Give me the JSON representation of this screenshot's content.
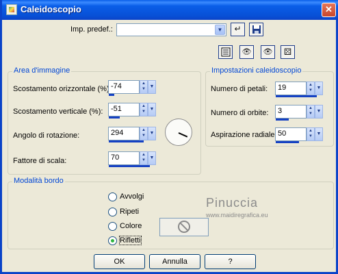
{
  "window": {
    "title": "Caleidoscopio",
    "close_glyph": "✕"
  },
  "preset": {
    "label": "Imp. predef.:",
    "value": ""
  },
  "area_group": {
    "title": "Area d'immagine",
    "fields": [
      {
        "label": "Scostamento orizzontale (%):",
        "value": "-74",
        "level": 0.13
      },
      {
        "label": "Scostamento verticale (%):",
        "value": "-51",
        "level": 0.25
      },
      {
        "label": "Angolo di rotazione:",
        "value": "294",
        "level": 0.82
      },
      {
        "label": "Fattore di scala:",
        "value": "70",
        "level": 0.97
      }
    ]
  },
  "settings_group": {
    "title": "Impostazioni caleidoscopio",
    "fields": [
      {
        "label": "Numero di petali:",
        "value": "19",
        "level": 0.97
      },
      {
        "label": "Numero di orbite:",
        "value": "3",
        "level": 0.3
      },
      {
        "label": "Aspirazione radiale:",
        "value": "50",
        "level": 0.55
      }
    ]
  },
  "border_group": {
    "title": "Modalità bordo",
    "options": [
      "Avvolgi",
      "Ripeti",
      "Colore",
      "Rifletti"
    ],
    "selected": "Rifletti"
  },
  "watermark": {
    "name": "Pinuccia",
    "url": "www.maidiregrafica.eu"
  },
  "buttons": {
    "ok": "OK",
    "cancel": "Annulla",
    "help": "?"
  },
  "icons": {
    "save_preset": "arrow-return-icon",
    "save_disk": "floppy-disk-icon",
    "reset": "list-reset-icon",
    "proof": "eye-toggle-icon",
    "preview": "eye-icon",
    "randomize": "dice-icon"
  },
  "colors": {
    "titlebar": "#0a5ee8",
    "group_title": "#0046d5",
    "selected_radio": "#2eb540"
  }
}
